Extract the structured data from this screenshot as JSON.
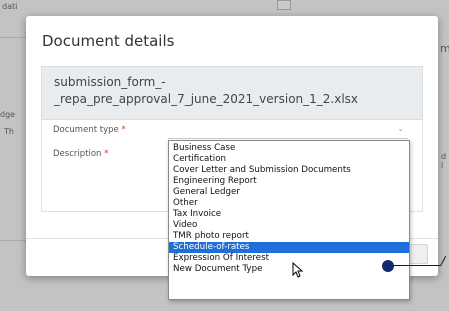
{
  "background": {
    "fragments": [
      "dati",
      "m",
      "dge",
      "Th",
      "d l"
    ]
  },
  "modal": {
    "title": "Document details",
    "file_name_line1": "submission_form_-",
    "file_name_line2": "_repa_pre_approval_7_june_2021_version_1_2.xlsx",
    "fields": {
      "document_type_label": "Document type",
      "description_label": "Description",
      "required_marker": "*"
    }
  },
  "dropdown": {
    "selected": "Schedule-of-rates",
    "options": [
      "Business Case",
      "Certification",
      "Cover Letter and Submission Documents",
      "Engineering Report",
      "General Ledger",
      "Other",
      "Tax Invoice",
      "Video",
      "TMR photo report",
      "Schedule-of-rates",
      "Expression Of Interest",
      "New Document Type"
    ]
  },
  "colors": {
    "selection": "#1e6fd9",
    "annotation_dot": "#13296b"
  }
}
